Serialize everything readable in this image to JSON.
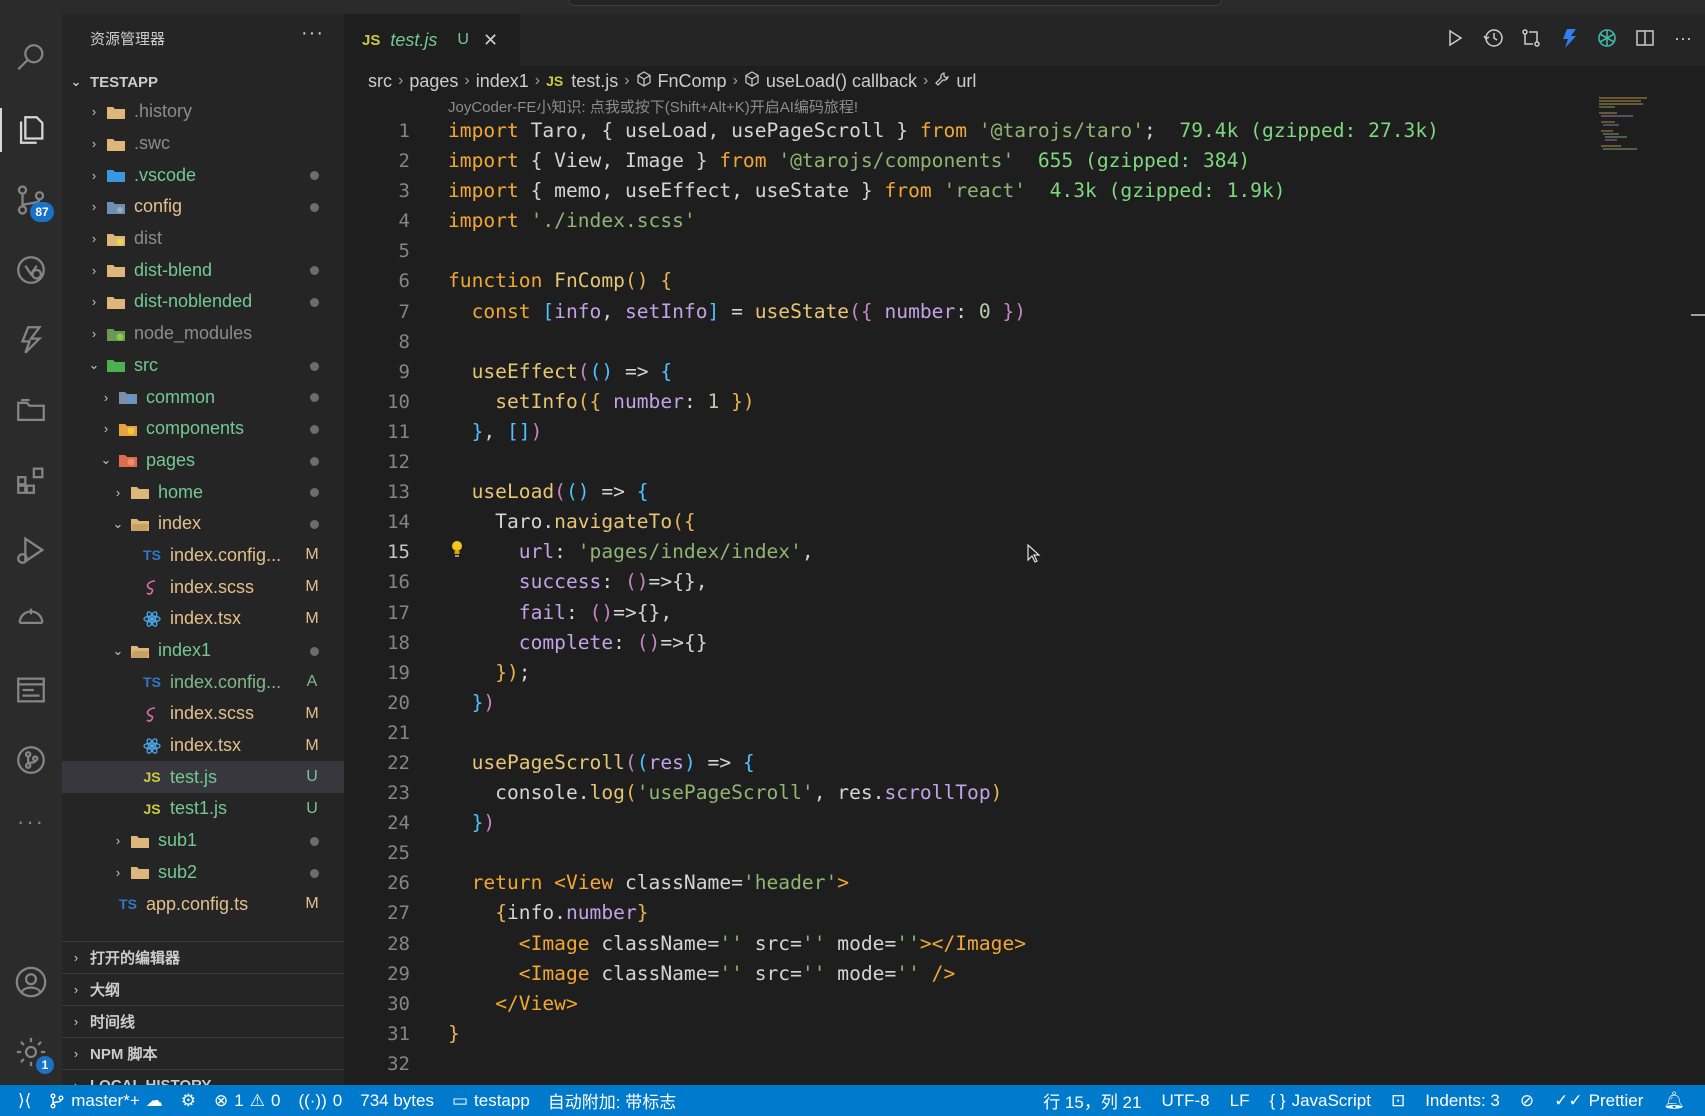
{
  "activity": {
    "scm_badge": "87",
    "settings_badge": "1"
  },
  "sidebar": {
    "title": "资源管理器",
    "more": "···",
    "root": "TESTAPP",
    "items": [
      {
        "label": ".history",
        "status": ""
      },
      {
        "label": ".swc",
        "status": ""
      },
      {
        "label": ".vscode",
        "status": ""
      },
      {
        "label": "config",
        "status": ""
      },
      {
        "label": "dist",
        "status": ""
      },
      {
        "label": "dist-blend",
        "status": ""
      },
      {
        "label": "dist-noblended",
        "status": ""
      },
      {
        "label": "node_modules",
        "status": ""
      },
      {
        "label": "src",
        "status": ""
      },
      {
        "label": "common",
        "status": ""
      },
      {
        "label": "components",
        "status": ""
      },
      {
        "label": "pages",
        "status": ""
      },
      {
        "label": "home",
        "status": ""
      },
      {
        "label": "index",
        "status": ""
      },
      {
        "label": "index.config...",
        "status": "M"
      },
      {
        "label": "index.scss",
        "status": "M"
      },
      {
        "label": "index.tsx",
        "status": "M"
      },
      {
        "label": "index1",
        "status": ""
      },
      {
        "label": "index.config...",
        "status": "A"
      },
      {
        "label": "index.scss",
        "status": "M"
      },
      {
        "label": "index.tsx",
        "status": "M"
      },
      {
        "label": "test.js",
        "status": "U"
      },
      {
        "label": "test1.js",
        "status": "U"
      },
      {
        "label": "sub1",
        "status": ""
      },
      {
        "label": "sub2",
        "status": ""
      },
      {
        "label": "app.config.ts",
        "status": "M"
      }
    ],
    "sections": [
      "打开的编辑器",
      "大纲",
      "时间线",
      "NPM 脚本",
      "LOCAL HISTORY"
    ]
  },
  "tab": {
    "icon": "JS",
    "name": "test.js",
    "status": "U"
  },
  "breadcrumb": {
    "parts": [
      "src",
      "pages",
      "index1",
      "test.js",
      "FnComp",
      "useLoad() callback",
      "url"
    ],
    "js_icon": "JS"
  },
  "editor": {
    "hint": "JoyCoder-FE小知识: 点我或按下(Shift+Alt+K)开启AI编码旅程!",
    "line_numbers": [
      "1",
      "2",
      "3",
      "4",
      "5",
      "6",
      "7",
      "8",
      "9",
      "10",
      "11",
      "12",
      "13",
      "14",
      "15",
      "16",
      "17",
      "18",
      "19",
      "20",
      "21",
      "22",
      "23",
      "24",
      "25",
      "26",
      "27",
      "28",
      "29",
      "30",
      "31",
      "32"
    ],
    "active_line": "15",
    "import_sizes": [
      "79.4k (gzipped: 27.3k)",
      "655 (gzipped: 384)",
      "4.3k (gzipped: 1.9k)"
    ],
    "code": {
      "taro_pkg": "'@tarojs/taro'",
      "comp_pkg": "'@tarojs/components'",
      "react_pkg": "'react'",
      "scss_path": "'./index.scss'",
      "fn_name": "FnComp",
      "url_value": "'pages/index/index'",
      "log_str": "'usePageScroll'",
      "class_header": "'header'"
    }
  },
  "status": {
    "branch": "master*+",
    "errors": "1",
    "warnings": "0",
    "ports": "0",
    "size": "734 bytes",
    "folder": "testapp",
    "auto_attach": "自动附加: 带标志",
    "position": "行 15，列 21",
    "encoding": "UTF-8",
    "eol": "LF",
    "language": "JavaScript",
    "indent": "Indents: 3",
    "formatter": "Prettier"
  },
  "colors": {
    "accent": "#007acc",
    "modified": "#e2c08d",
    "untracked": "#73c991",
    "added": "#81b88b"
  }
}
